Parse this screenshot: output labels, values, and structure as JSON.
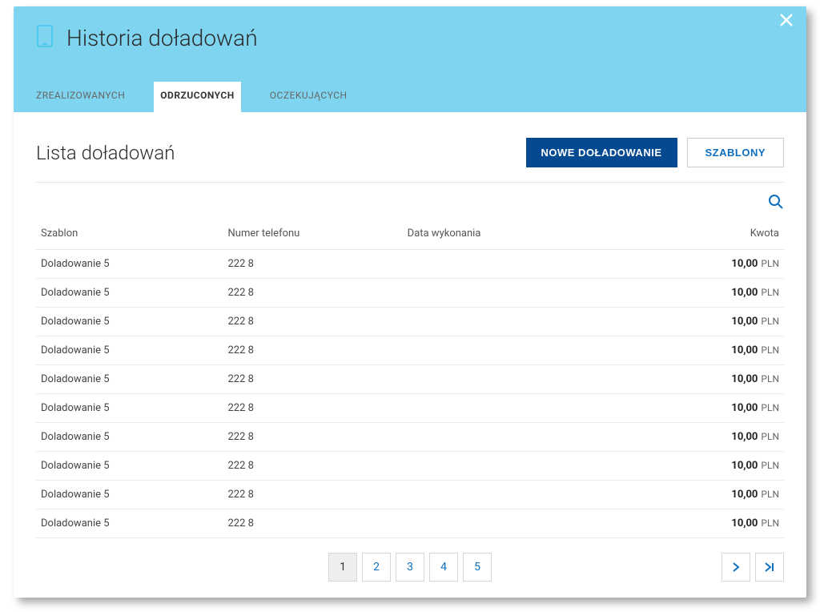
{
  "header": {
    "title": "Historia doładowań",
    "tabs": [
      {
        "label": "ZREALIZOWANYCH",
        "active": false
      },
      {
        "label": "ODRZUCONYCH",
        "active": true
      },
      {
        "label": "OCZEKUJĄCYCH",
        "active": false
      }
    ]
  },
  "list": {
    "title": "Lista doładowań",
    "primary_btn": "NOWE DOŁADOWANIE",
    "secondary_btn": "SZABLONY"
  },
  "columns": {
    "template": "Szablon",
    "phone": "Numer telefonu",
    "date": "Data wykonania",
    "amount": "Kwota"
  },
  "rows": [
    {
      "template": "Doladowanie 5",
      "phone": "222 8",
      "date": "",
      "amount": "10,00",
      "currency": "PLN"
    },
    {
      "template": "Doladowanie 5",
      "phone": "222 8",
      "date": "",
      "amount": "10,00",
      "currency": "PLN"
    },
    {
      "template": "Doladowanie 5",
      "phone": "222 8",
      "date": "",
      "amount": "10,00",
      "currency": "PLN"
    },
    {
      "template": "Doladowanie 5",
      "phone": "222 8",
      "date": "",
      "amount": "10,00",
      "currency": "PLN"
    },
    {
      "template": "Doladowanie 5",
      "phone": "222 8",
      "date": "",
      "amount": "10,00",
      "currency": "PLN"
    },
    {
      "template": "Doladowanie 5",
      "phone": "222 8",
      "date": "",
      "amount": "10,00",
      "currency": "PLN"
    },
    {
      "template": "Doladowanie 5",
      "phone": "222 8",
      "date": "",
      "amount": "10,00",
      "currency": "PLN"
    },
    {
      "template": "Doladowanie 5",
      "phone": "222 8",
      "date": "",
      "amount": "10,00",
      "currency": "PLN"
    },
    {
      "template": "Doladowanie 5",
      "phone": "222 8",
      "date": "",
      "amount": "10,00",
      "currency": "PLN"
    },
    {
      "template": "Doladowanie 5",
      "phone": "222 8",
      "date": "",
      "amount": "10,00",
      "currency": "PLN"
    }
  ],
  "pagination": {
    "pages": [
      "1",
      "2",
      "3",
      "4",
      "5"
    ],
    "active": "1"
  }
}
